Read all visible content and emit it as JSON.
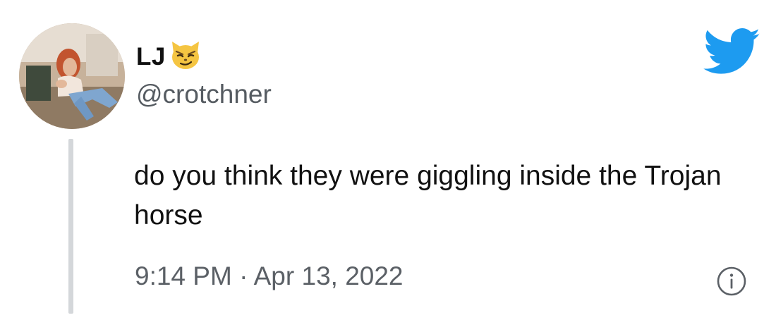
{
  "tweet": {
    "display_name": "LJ",
    "name_emoji": "smirking-cat-emoji",
    "handle": "@crotchner",
    "text": "do you think they were giggling inside the Trojan horse",
    "timestamp": "9:14 PM · Apr 13, 2022"
  },
  "icons": {
    "brand": "twitter-bird-icon",
    "info": "info-icon"
  },
  "colors": {
    "twitter_blue": "#1D9BF0",
    "text_primary": "#111111",
    "text_secondary": "#5B6066",
    "thread_line": "#D4D7DA",
    "emoji_yellow": "#F5C542"
  }
}
